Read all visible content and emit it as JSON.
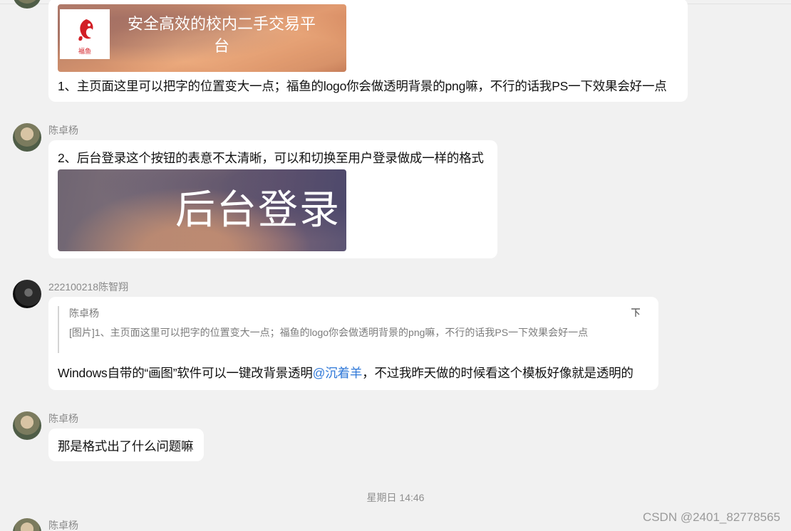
{
  "messages": [
    {
      "image_text": "安全高效的校内二手交易平台",
      "logo_text": "福鱼",
      "text": "1、主页面这里可以把字的位置变大一点；福鱼的logo你会做透明背景的png嘛，不行的话我PS一下效果会好一点"
    },
    {
      "sender": "陈卓杨",
      "text": "2、后台登录这个按钮的表意不太清晰，可以和切换至用户登录做成一样的格式",
      "image_text": "后台登录"
    },
    {
      "sender": "222100218陈智翔",
      "quote_author": "陈卓杨",
      "quote_text": "[图片]1、主页面这里可以把字的位置变大一点；福鱼的logo你会做透明背景的png嘛，不行的话我PS一下效果会好一点",
      "text_before": "Windows自带的“画图”软件可以一键改背景透明",
      "mention": "@沉着羊",
      "text_after": "，不过我昨天做的时候看这个模板好像就是透明的"
    },
    {
      "sender": "陈卓杨",
      "text": "那是格式出了什么问题嘛"
    },
    {
      "sender": "陈卓杨"
    }
  ],
  "timestamp": "星期日 14:46",
  "watermark": "CSDN @2401_82778565",
  "colors": {
    "mention": "#2f78d8",
    "background": "#f1f1f1",
    "bubble": "#ffffff"
  },
  "icons": {
    "quote_collapse": "collapse-quote-icon"
  }
}
